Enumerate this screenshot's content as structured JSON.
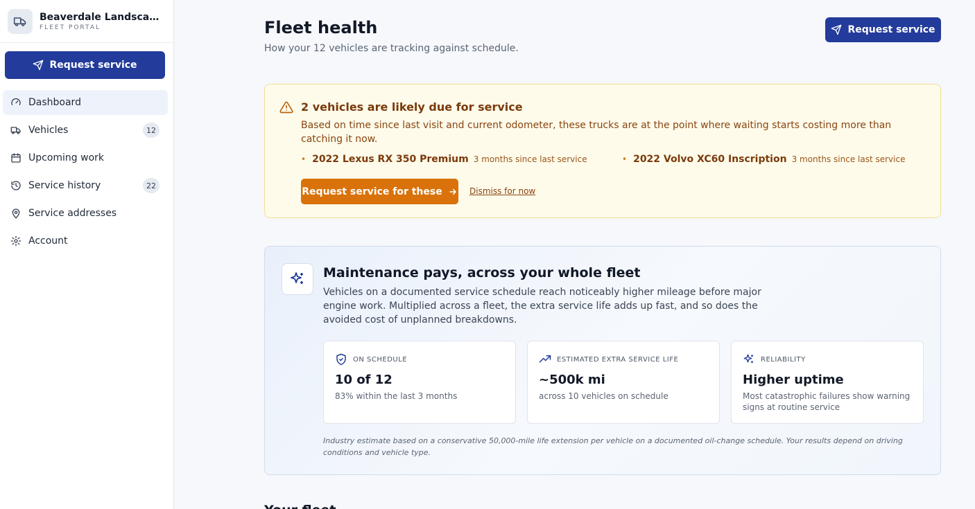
{
  "brand": {
    "name": "Beaverdale Landscaping",
    "subtitle": "FLEET PORTAL"
  },
  "sidebar": {
    "request_label": "Request service",
    "items": [
      {
        "label": "Dashboard",
        "icon": "gauge-icon",
        "badge": ""
      },
      {
        "label": "Vehicles",
        "icon": "truck-icon",
        "badge": "12"
      },
      {
        "label": "Upcoming work",
        "icon": "calendar-icon",
        "badge": ""
      },
      {
        "label": "Service history",
        "icon": "history-icon",
        "badge": "22"
      },
      {
        "label": "Service addresses",
        "icon": "map-pin-icon",
        "badge": ""
      },
      {
        "label": "Account",
        "icon": "gear-icon",
        "badge": ""
      }
    ],
    "active_item": "Dashboard"
  },
  "header": {
    "title": "Fleet health",
    "subtitle": "How your 12 vehicles are tracking against schedule.",
    "request_label": "Request service"
  },
  "alert": {
    "title": "2 vehicles are likely due for service",
    "body": "Based on time since last visit and current odometer, these trucks are at the point where waiting starts costing more than catching it now.",
    "vehicles": [
      {
        "name": "2022 Lexus RX 350 Premium",
        "meta": "3 months since last service"
      },
      {
        "name": "2022 Volvo XC60 Inscription",
        "meta": "3 months since last service"
      }
    ],
    "cta_label": "Request service for these",
    "dismiss_label": "Dismiss for now"
  },
  "info": {
    "title": "Maintenance pays, across your whole fleet",
    "body": "Vehicles on a documented service schedule reach noticeably higher mileage before major engine work. Multiplied across a fleet, the extra service life adds up fast, and so does the avoided cost of unplanned breakdowns.",
    "stats": [
      {
        "label": "ON SCHEDULE",
        "value": "10 of 12",
        "note": "83% within the last 3 months",
        "icon": "shield-check-icon"
      },
      {
        "label": "ESTIMATED EXTRA SERVICE LIFE",
        "value": "~500k mi",
        "note": "across 10 vehicles on schedule",
        "icon": "trending-up-icon"
      },
      {
        "label": "RELIABILITY",
        "value": "Higher uptime",
        "note": "Most catastrophic failures show warning signs at routine service",
        "icon": "sparkles-icon"
      }
    ],
    "footnote": "Industry estimate based on a conservative 50,000-mile life extension per vehicle on a documented oil-change schedule. Your results depend on driving conditions and vehicle type."
  },
  "fleet": {
    "heading": "Your fleet"
  },
  "colors": {
    "primary": "#233b9a",
    "warning_bg": "#fefbea",
    "warning_cta": "#d9720a",
    "warning_text": "#7a3a0c"
  }
}
